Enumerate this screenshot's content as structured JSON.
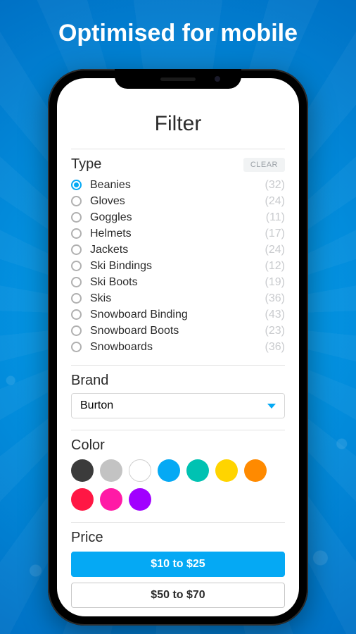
{
  "headline": "Optimised for mobile",
  "page_title": "Filter",
  "sections": {
    "type": {
      "title": "Type",
      "clear_label": "CLEAR",
      "items": [
        {
          "label": "Beanies",
          "count": "(32)",
          "selected": true
        },
        {
          "label": "Gloves",
          "count": "(24)",
          "selected": false
        },
        {
          "label": "Goggles",
          "count": "(11)",
          "selected": false
        },
        {
          "label": "Helmets",
          "count": "(17)",
          "selected": false
        },
        {
          "label": "Jackets",
          "count": "(24)",
          "selected": false
        },
        {
          "label": "Ski Bindings",
          "count": "(12)",
          "selected": false
        },
        {
          "label": "Ski Boots",
          "count": "(19)",
          "selected": false
        },
        {
          "label": "Skis",
          "count": "(36)",
          "selected": false
        },
        {
          "label": "Snowboard Binding",
          "count": "(43)",
          "selected": false
        },
        {
          "label": "Snowboard Boots",
          "count": "(23)",
          "selected": false
        },
        {
          "label": "Snowboards",
          "count": "(36)",
          "selected": false
        }
      ]
    },
    "brand": {
      "title": "Brand",
      "selected": "Burton"
    },
    "color": {
      "title": "Color",
      "swatches": [
        "#3b3b3b",
        "#c3c3c3",
        "#ffffff",
        "#05a9f4",
        "#00c2b2",
        "#ffd400",
        "#ff8a00",
        "#ff1744",
        "#ff1aa6",
        "#a100ff"
      ]
    },
    "price": {
      "title": "Price",
      "ranges": [
        {
          "label": "$10 to $25",
          "active": true
        },
        {
          "label": "$50 to $70",
          "active": false
        }
      ]
    }
  }
}
